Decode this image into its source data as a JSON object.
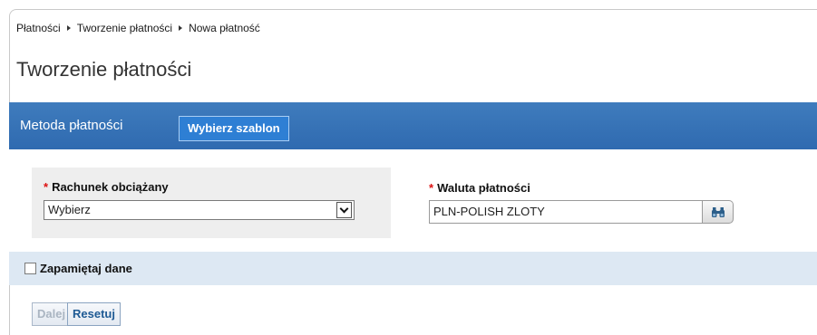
{
  "breadcrumb": {
    "items": [
      "Płatności",
      "Tworzenie płatności",
      "Nowa płatność"
    ]
  },
  "page_title": "Tworzenie płatności",
  "payment_method": {
    "label": "Metoda płatności",
    "template_button": "Wybierz szablon"
  },
  "form": {
    "account_label": "Rachunek obciążany",
    "account_selected": "Wybierz",
    "currency_label": "Waluta płatności",
    "currency_value": "PLN-POLISH ZLOTY",
    "required_marker": "*"
  },
  "remember": {
    "label": "Zapamiętaj dane",
    "checked": false
  },
  "actions": {
    "next_label": "Dalej",
    "reset_label": "Resetuj"
  },
  "icons": {
    "lookup": "binoculars-icon",
    "dropdown": "chevron-down-icon",
    "breadcrumb_separator": "triangle-right-icon"
  },
  "colors": {
    "method_bar": "#3474b9",
    "template_button": "#2e7fd4",
    "remember_bar": "#dde8f3",
    "required": "#dd1111"
  }
}
